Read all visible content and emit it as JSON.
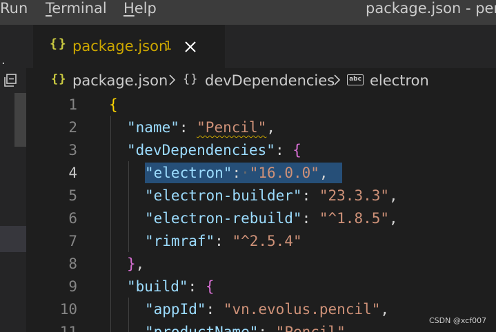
{
  "menubar": {
    "items": [
      {
        "label": "Run"
      },
      {
        "label": "Terminal",
        "mnemonic": "T",
        "rest": "erminal"
      },
      {
        "label": "Help",
        "mnemonic": "H",
        "rest": "elp"
      }
    ],
    "window_title": "package.json - penci"
  },
  "activity": {
    "dots": "·",
    "collapse_icon": "collapse-all-icon"
  },
  "tab": {
    "icon": "{}",
    "label": "package.json",
    "problem_count": "1",
    "close_icon": "close-icon"
  },
  "breadcrumb": {
    "file_icon": "{}",
    "file": "package.json",
    "object_icon": "{}",
    "object": "devDependencies",
    "string_icon": "abc",
    "property": "electron"
  },
  "editor": {
    "lines": [
      {
        "num": "1",
        "text": "{"
      },
      {
        "num": "2",
        "text": "\"name\": \"Pencil\","
      },
      {
        "num": "3",
        "text": "\"devDependencies\": {"
      },
      {
        "num": "4",
        "text": "\"electron\": \"16.0.0\","
      },
      {
        "num": "5",
        "text": "\"electron-builder\": \"23.3.3\","
      },
      {
        "num": "6",
        "text": "\"electron-rebuild\": \"^1.8.5\","
      },
      {
        "num": "7",
        "text": "\"rimraf\": \"^2.5.4\""
      },
      {
        "num": "8",
        "text": "},"
      },
      {
        "num": "9",
        "text": "\"build\": {"
      },
      {
        "num": "10",
        "text": "\"appId\": \"vn.evolus.pencil\","
      },
      {
        "num": "11",
        "text": "\"productName\": \"Pencil\","
      }
    ],
    "active_line": "4",
    "selected_text": "\"electron\": \"16.0.0\","
  },
  "watermark": "CSDN @xcf007",
  "colors": {
    "background": "#1e1e1e",
    "titlebar": "#3c3c3c",
    "key": "#9cdcfe",
    "string": "#ce9178",
    "selection": "#264f78",
    "warning": "#cca700"
  }
}
